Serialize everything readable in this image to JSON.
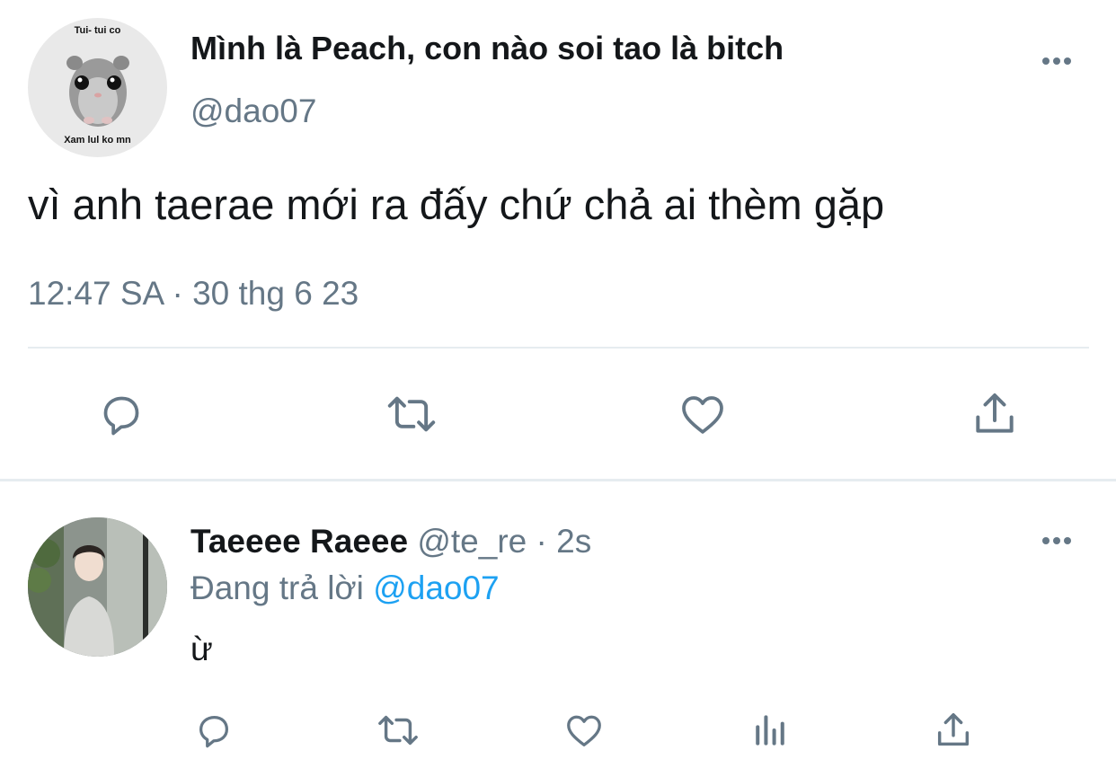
{
  "main_tweet": {
    "avatar_caption_top": "Tui- tui co",
    "avatar_caption_bottom": "Xam lul ko mn",
    "display_name": "Mình là Peach, con nào soi tao là bitch",
    "handle": "@dao07",
    "text": "vì anh taerae mới ra đấy chứ chả ai thèm gặp",
    "time": "12:47 SA",
    "separator": "·",
    "date": "30 thg 6 23",
    "actions": [
      "reply-icon",
      "retweet-icon",
      "like-icon",
      "share-icon"
    ]
  },
  "reply": {
    "display_name": "Taeeee Raeee",
    "handle": "@te_re",
    "separator": "·",
    "age": "2s",
    "replying_to_label": "Đang trả lời",
    "replying_to_handle": "@dao07",
    "text": "ừ",
    "actions": [
      "reply-icon",
      "retweet-icon",
      "like-icon",
      "analytics-icon",
      "share-icon"
    ]
  },
  "colors": {
    "text": "#14171a",
    "secondary": "#657786",
    "accent": "#1da1f2",
    "divider": "#e6ecf0"
  }
}
